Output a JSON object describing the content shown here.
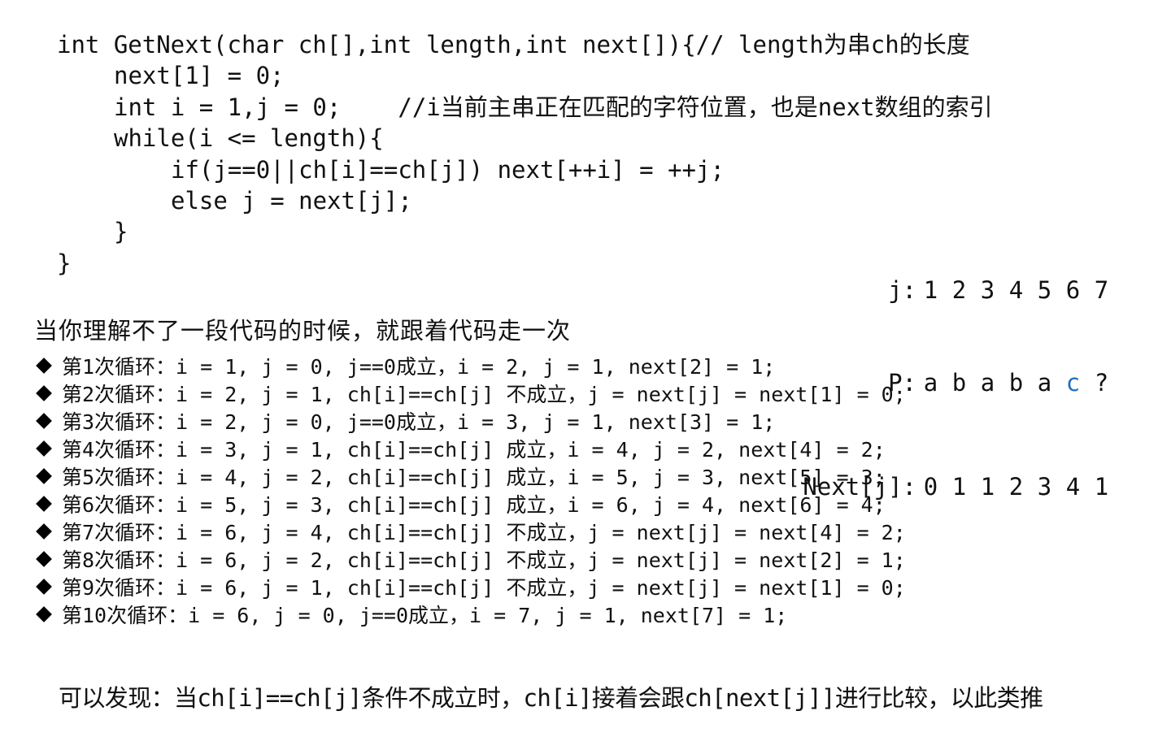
{
  "code": {
    "lines": [
      "int GetNext(char ch[],int length,int next[]){// length为串ch的长度",
      "next[1] = 0;",
      "int i = 1,j = 0;",
      "//i当前主串正在匹配的字符位置，也是next数组的索引",
      "while(i <= length){",
      "if(j==0||ch[i]==ch[j]) next[++i] = ++j;",
      "else j = next[j];",
      "}",
      "}"
    ]
  },
  "sequence": {
    "j_label": "j:",
    "j_values": [
      "1",
      "2",
      "3",
      "4",
      "5",
      "6",
      "7"
    ],
    "p_label": "P:",
    "p_values": [
      "a",
      "b",
      "a",
      "b",
      "a",
      "c",
      "?"
    ],
    "highlight_color": "#1f6fc2",
    "next_label": "Next[j]:",
    "next_values": [
      "0",
      "1",
      "1",
      "2",
      "3",
      "4",
      "1"
    ]
  },
  "hint": "当你理解不了一段代码的时候，就跟着代码走一次",
  "loops": [
    "第1次循环：i = 1, j = 0, j==0成立，i = 2, j = 1, next[2] = 1;",
    "第2次循环：i = 2, j = 1, ch[i]==ch[j] 不成立，j = next[j] = next[1] = 0;",
    "第3次循环：i = 2, j = 0, j==0成立，i = 3, j = 1, next[3] = 1;",
    "第4次循环：i = 3, j = 1, ch[i]==ch[j] 成立，i = 4, j = 2, next[4] = 2;",
    "第5次循环：i = 4, j = 2, ch[i]==ch[j] 成立，i = 5, j = 3, next[5] = 3;",
    "第6次循环：i = 5, j = 3, ch[i]==ch[j] 成立，i = 6, j = 4, next[6] = 4;",
    "第7次循环：i = 6, j = 4, ch[i]==ch[j] 不成立，j = next[j] = next[4] = 2;",
    "第8次循环：i = 6, j = 2, ch[i]==ch[j] 不成立，j = next[j] = next[2] = 1;",
    "第9次循环：i = 6, j = 1, ch[i]==ch[j] 不成立，j = next[j] = next[1] = 0;",
    "第10次循环：i = 6, j = 0, j==0成立，i = 7, j = 1, next[7] = 1;"
  ],
  "conclusion": "可以发现：当ch[i]==ch[j]条件不成立时，ch[i]接着会跟ch[next[j]]进行比较，以此类推"
}
